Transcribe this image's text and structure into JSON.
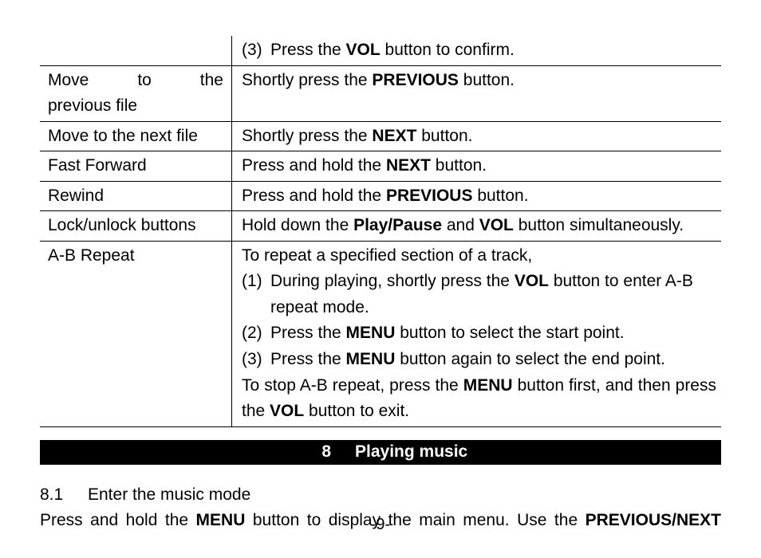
{
  "table": {
    "rows": [
      {
        "left": "",
        "right_num": "(3)",
        "right_before": "Press the ",
        "right_bold": "VOL",
        "right_after": " button to confirm."
      },
      {
        "left_line1_w1": "Move",
        "left_line1_w2": "to",
        "left_line1_w3": "the",
        "left_line2": "previous file",
        "right_before": "Shortly press the ",
        "right_bold": "PREVIOUS",
        "right_after": " button."
      },
      {
        "left": "Move to the next file",
        "right_before": "Shortly press the ",
        "right_bold": "NEXT",
        "right_after": " button."
      },
      {
        "left": "Fast Forward",
        "right_before": "Press and hold the ",
        "right_bold": "NEXT",
        "right_after": " button."
      },
      {
        "left": "Rewind",
        "right_before": "Press and hold the ",
        "right_bold": "PREVIOUS",
        "right_after": " button."
      },
      {
        "left": "Lock/unlock buttons",
        "right_before": "Hold down the ",
        "right_bold1": "Play/Pause",
        "right_mid": " and ",
        "right_bold2": "VOL",
        "right_after": " button simultaneously."
      },
      {
        "left": "A-B Repeat",
        "intro": "To repeat a specified section of a track,",
        "i1_n": "(1)",
        "i1_before": "During playing, shortly press the ",
        "i1_bold": "VOL",
        "i1_after": " button to enter A-B repeat mode.",
        "i2_n": "(2)",
        "i2_before": "Press the ",
        "i2_bold": "MENU",
        "i2_after": " button to select the start point.",
        "i3_n": "(3)",
        "i3_before": "Press the ",
        "i3_bold": "MENU",
        "i3_after": " button again to select the end point.",
        "outro_before": "To stop A-B repeat, press the ",
        "outro_bold1": "MENU",
        "outro_mid": " button first, and then press the ",
        "outro_bold2": "VOL",
        "outro_after": " button to exit."
      }
    ]
  },
  "section": {
    "number": "8",
    "title": "Playing music"
  },
  "subsection": {
    "number": "8.1",
    "title": "Enter the music mode"
  },
  "paragraph": {
    "before": "Press and hold the ",
    "bold1": "MENU",
    "mid": " button to display the main menu. Use the ",
    "bold2": "PREVIOUS/NEXT"
  },
  "footer": "-9-"
}
